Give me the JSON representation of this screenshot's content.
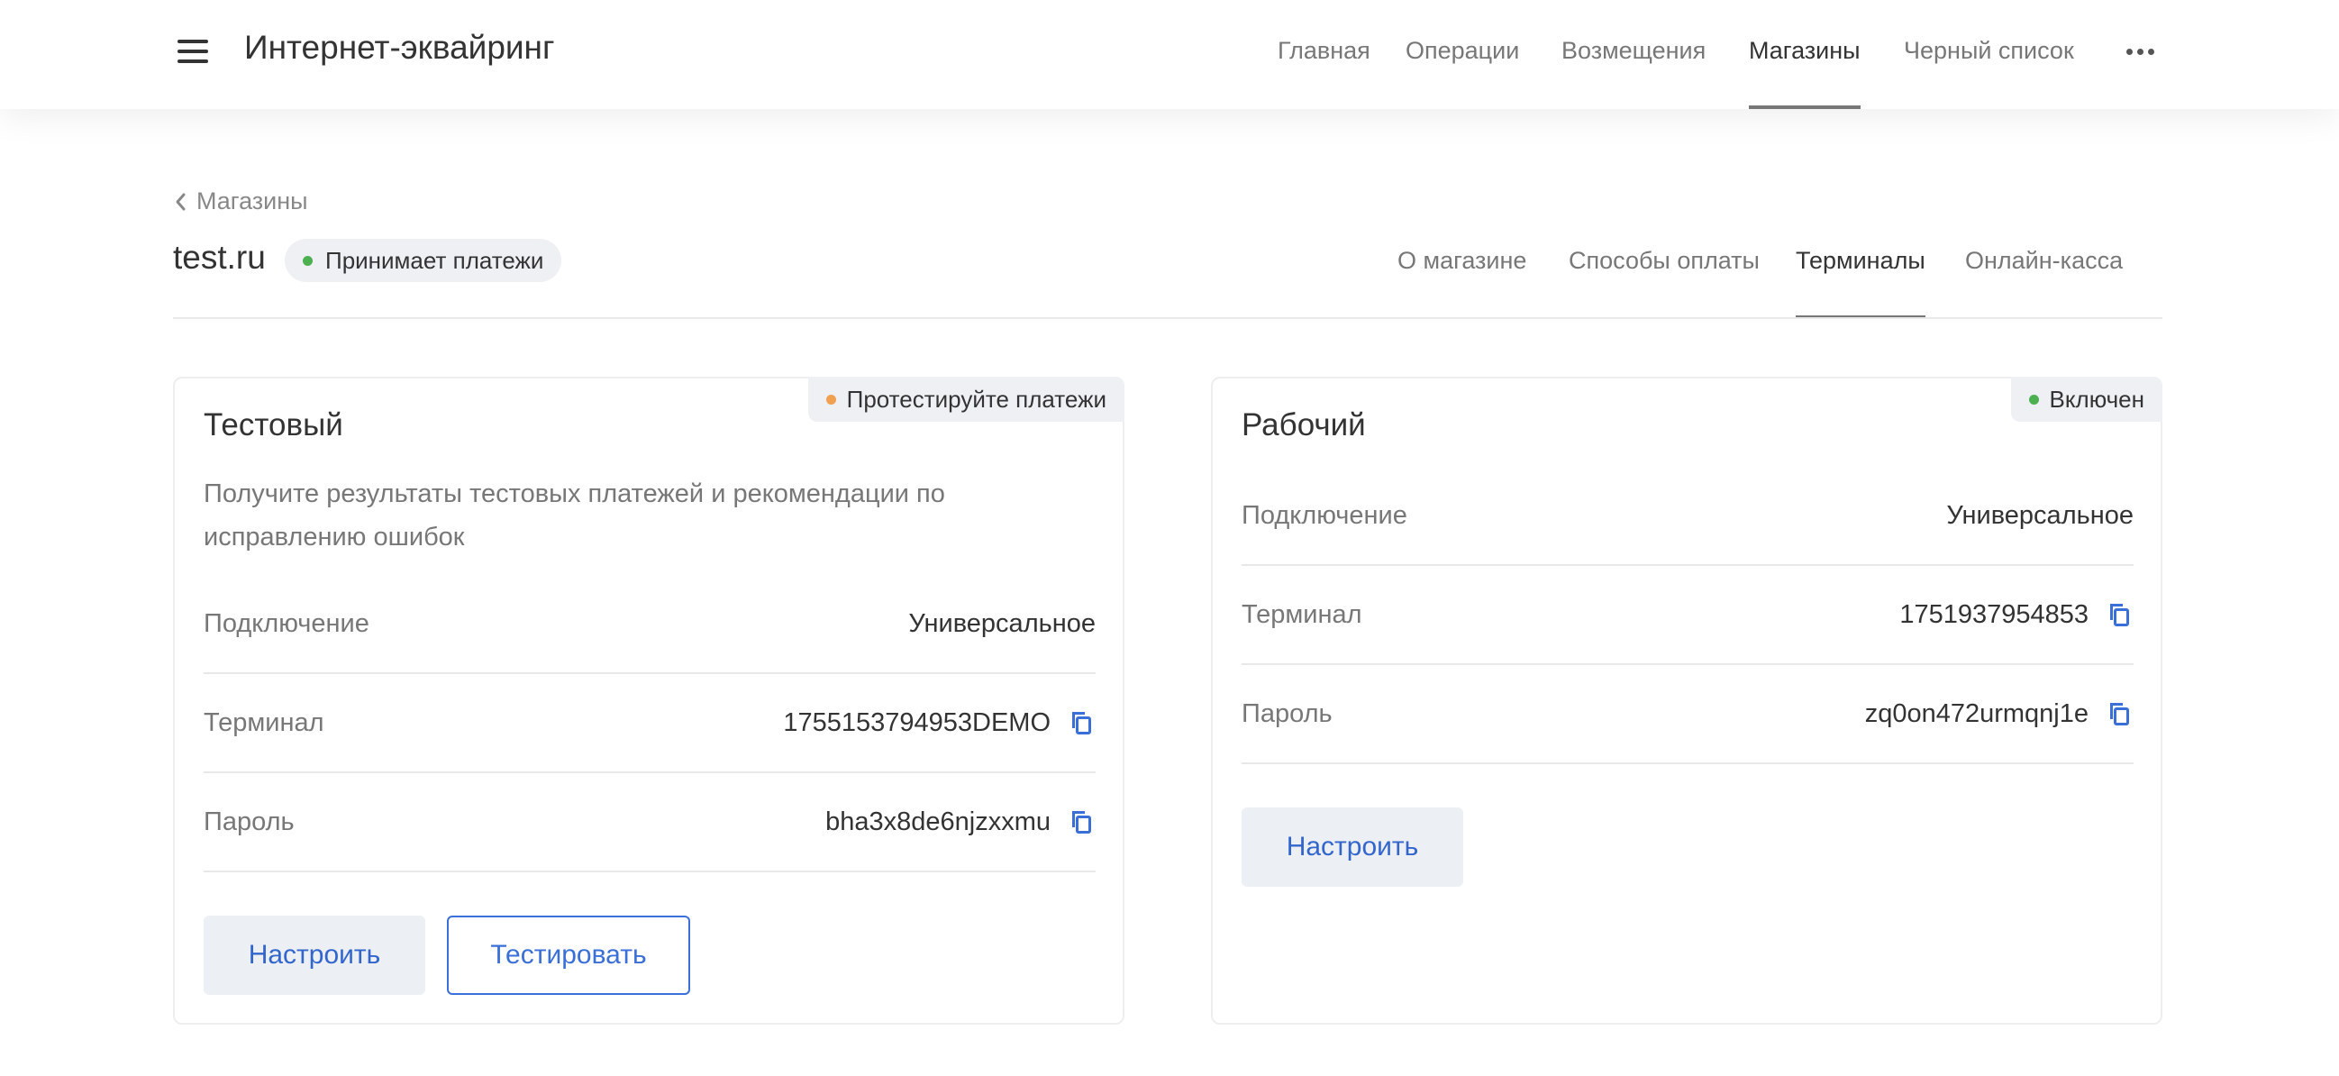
{
  "header": {
    "title": "Интернет-эквайринг",
    "nav": [
      {
        "label": "Главная",
        "active": false
      },
      {
        "label": "Операции",
        "active": false
      },
      {
        "label": "Возмещения",
        "active": false
      },
      {
        "label": "Магазины",
        "active": true
      },
      {
        "label": "Черный список",
        "active": false
      }
    ],
    "menu_icon": "hamburger-icon",
    "more_icon": "more-horizontal-icon"
  },
  "breadcrumb": {
    "label": "Магазины",
    "icon": "chevron-left-icon"
  },
  "shop": {
    "name": "test.ru",
    "status": "Принимает платежи",
    "status_color": "#4caf50"
  },
  "tabs": [
    {
      "label": "О магазине",
      "active": false
    },
    {
      "label": "Способы оплаты",
      "active": false
    },
    {
      "label": "Терминалы",
      "active": true
    },
    {
      "label": "Онлайн-касса",
      "active": false
    }
  ],
  "cards": {
    "test": {
      "title": "Тестовый",
      "badge": "Протестируйте платежи",
      "badge_color": "#f0a050",
      "description": "Получите результаты тестовых платежей и рекомендации по исправлению ошибок",
      "rows": [
        {
          "label": "Подключение",
          "value": "Универсальное"
        },
        {
          "label": "Терминал",
          "value": "1755153794953DEMO"
        },
        {
          "label": "Пароль",
          "value": "bha3x8de6njzxxmu"
        }
      ],
      "configure_label": "Настроить",
      "test_label": "Тестировать"
    },
    "work": {
      "title": "Рабочий",
      "badge": "Включен",
      "badge_color": "#4caf50",
      "rows": [
        {
          "label": "Подключение",
          "value": "Универсальное"
        },
        {
          "label": "Терминал",
          "value": "1751937954853"
        },
        {
          "label": "Пароль",
          "value": "zq0on472urmqnj1e"
        }
      ],
      "configure_label": "Настроить"
    }
  },
  "colors": {
    "accent": "#3366cc",
    "copy_icon": "#3b6fd8",
    "button_bg": "#eceff4"
  },
  "icons": {
    "copy": "copy-icon"
  }
}
